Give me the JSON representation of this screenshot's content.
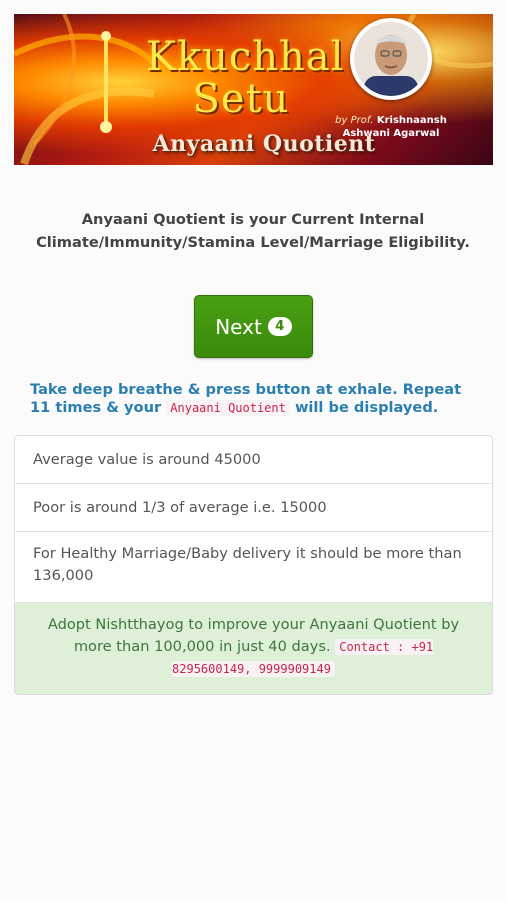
{
  "banner": {
    "title_line1": "Kkuchhal",
    "title_line2": "Setu",
    "author_by": "by Prof.",
    "author_name1": "Krishnaansh",
    "author_name2": "Ashwani Agarwal",
    "subtitle": "Anyaani Quotient"
  },
  "intro": {
    "text": "Anyaani Quotient is your Current Internal Climate/Immunity/Stamina Level/Marriage Eligibility."
  },
  "next_button": {
    "label": "Next",
    "count": "4"
  },
  "instruction": {
    "before": "Take deep breathe & press button at exhale. Repeat 11 times & your ",
    "code": "Anyaani Quotient",
    "after": " will be displayed."
  },
  "info_list": {
    "items": [
      "Average value is around 45000",
      "Poor is around 1/3 of average i.e. 15000",
      "For Healthy Marriage/Baby delivery it should be more than 136,000"
    ],
    "success_text": "Adopt Nishtthayog to improve your Anyaani Quotient by more than 100,000 in just 40 days.",
    "contact_code": "Contact : +91 8295600149, 9999909149"
  },
  "colors": {
    "next_button": "#3a8a0b",
    "instruction_text": "#2a7fb0",
    "success_bg": "#dff0d8",
    "success_text": "#3c763d",
    "code_text": "#c7254e"
  }
}
